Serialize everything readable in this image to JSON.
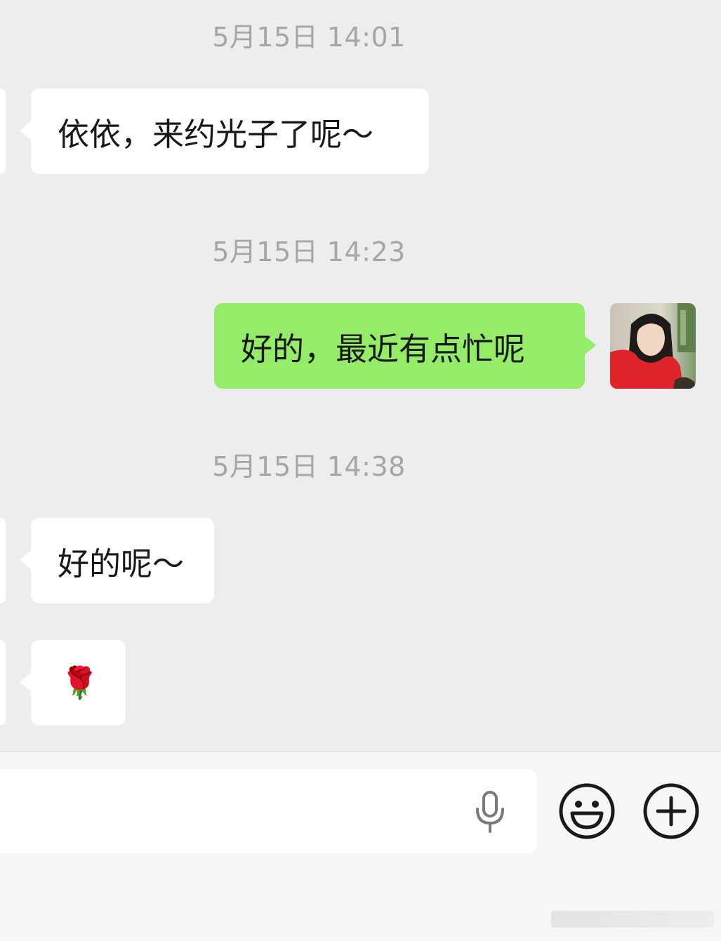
{
  "messages": [
    {
      "timestamp": "5月15日 14:01",
      "side": "left",
      "text": "依依，来约光子了呢～"
    },
    {
      "timestamp": "5月15日 14:23",
      "side": "right",
      "text": "好的，最近有点忙呢"
    },
    {
      "timestamp": "5月15日 14:38",
      "side": "left",
      "text": "好的呢～"
    },
    {
      "side": "left",
      "text": "🌹"
    }
  ],
  "input_bar": {
    "placeholder": "",
    "icons": [
      "microphone-icon",
      "emoji-icon",
      "plus-icon"
    ]
  },
  "colors": {
    "chat_background": "#ededed",
    "received_bubble": "#ffffff",
    "sent_bubble": "#95ec69",
    "timestamp_text": "#a6a6a6"
  }
}
